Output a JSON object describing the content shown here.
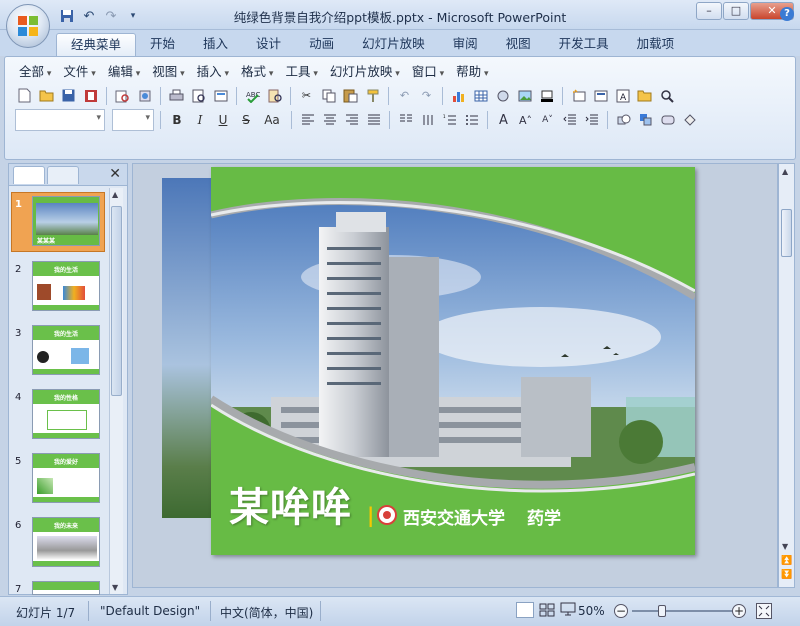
{
  "window": {
    "title": "纯绿色背景自我介绍ppt模板.pptx - Microsoft PowerPoint",
    "controls": [
      "–",
      "□",
      "✕"
    ]
  },
  "ribbon_tabs": [
    "经典菜单",
    "开始",
    "插入",
    "设计",
    "动画",
    "幻灯片放映",
    "审阅",
    "视图",
    "开发工具",
    "加载项"
  ],
  "menus": [
    "全部",
    "文件",
    "编辑",
    "视图",
    "插入",
    "格式",
    "工具",
    "幻灯片放映",
    "窗口",
    "帮助"
  ],
  "format_buttons": [
    "B",
    "I",
    "U",
    "S",
    "Aa"
  ],
  "left_panel": {
    "slide_numbers": [
      "1",
      "2",
      "3",
      "4",
      "5",
      "6",
      "7"
    ],
    "thumb_titles": [
      "",
      "我的生活",
      "我的生活",
      "我的性格",
      "我的爱好",
      "我的未来",
      ""
    ],
    "thumb1_text": "某某某"
  },
  "slide": {
    "name": "某哞哞",
    "separator": "|",
    "school": "西安交通大学",
    "major": "药学"
  },
  "status": {
    "slide_info": "幻灯片 1/7",
    "theme": "\"Default Design\"",
    "language": "中文(简体，中国)",
    "zoom": "50%",
    "zoom_fraction": 0.3
  },
  "colors": {
    "slide_green": "#67bb45",
    "office_blue": "#c7d8ee"
  }
}
